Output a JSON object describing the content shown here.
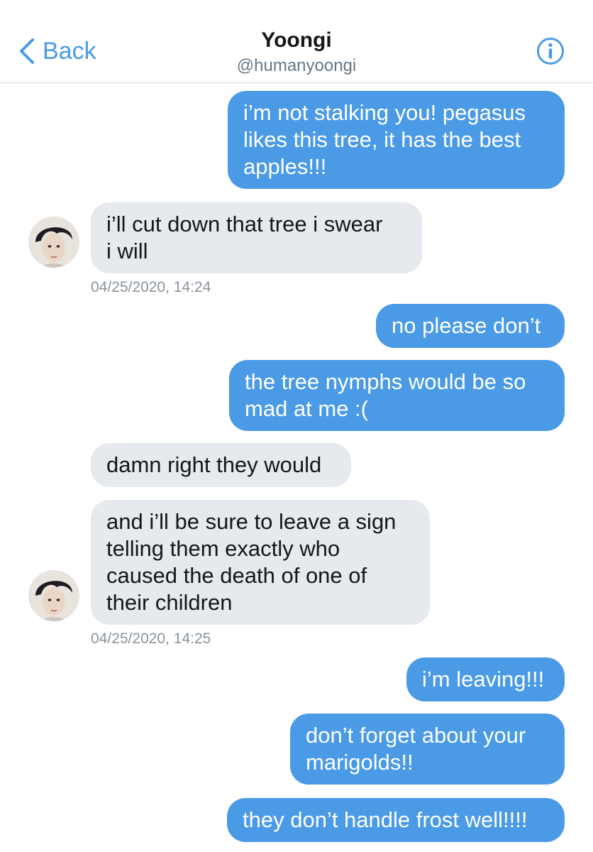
{
  "header": {
    "back_label": "Back",
    "title": "Yoongi",
    "handle": "@humanyoongi",
    "accent_color": "#4a9ae6",
    "back_icon": "chevron-left-icon",
    "info_icon": "info-icon"
  },
  "messages": [
    {
      "side": "sent",
      "text": "i’m not stalking you! pegasus\nlikes this tree, it has the best\napples!!!"
    },
    {
      "side": "received",
      "text": "i’ll cut down that tree i swear\ni will"
    },
    {
      "side": "timestamp",
      "text": "04/25/2020, 14:24"
    },
    {
      "side": "sent",
      "text": "no please don’t"
    },
    {
      "side": "sent",
      "text": "the tree nymphs would be so\nmad at me :("
    },
    {
      "side": "received",
      "text": "damn right they would"
    },
    {
      "side": "received",
      "text": "and i’ll be sure to leave a sign\ntelling them exactly who\ncaused the death of one of\ntheir children"
    },
    {
      "side": "timestamp",
      "text": "04/25/2020, 14:25"
    },
    {
      "side": "sent",
      "text": "i’m leaving!!!"
    },
    {
      "side": "sent",
      "text": "don’t forget about your\nmarigolds!!"
    },
    {
      "side": "sent",
      "text": "they don’t handle frost well!!!!"
    }
  ],
  "colors": {
    "sent_bubble": "#4a9ae6",
    "received_bubble": "#e6e9ee",
    "timestamp_text": "#8a939b"
  }
}
